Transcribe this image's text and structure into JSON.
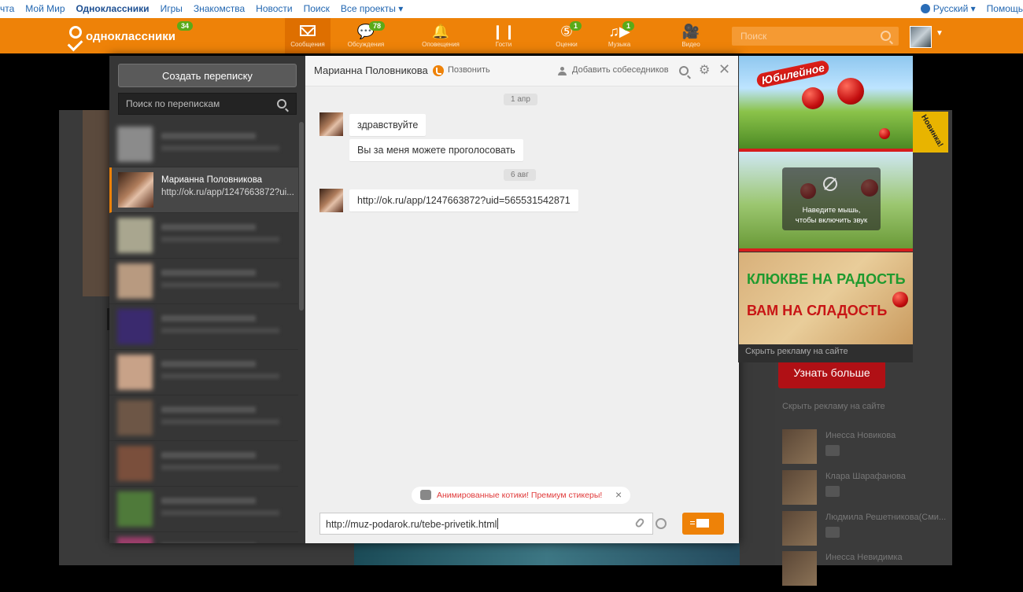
{
  "topbar": {
    "links": [
      "чта",
      "Мой Мир",
      "Одноклассники",
      "Игры",
      "Знакомства",
      "Новости",
      "Поиск",
      "Все проекты ▾"
    ],
    "language": "Русский ▾",
    "help": "Помощь"
  },
  "header": {
    "logo_text": "одноклассники",
    "logo_badge": "34",
    "search_placeholder": "Поиск",
    "nav": [
      {
        "label": "Сообщения",
        "icon": "envelope-icon",
        "badge": ""
      },
      {
        "label": "Обсуждения",
        "icon": "speech-bubbles-icon",
        "badge": "78"
      },
      {
        "label": "Оповещения",
        "icon": "bell-icon",
        "badge": ""
      },
      {
        "label": "Гости",
        "icon": "footprints-icon",
        "badge": ""
      },
      {
        "label": "Оценки",
        "icon": "rating-5-icon",
        "badge": "1"
      },
      {
        "label": "Музыка",
        "icon": "music-note-icon",
        "badge": "1"
      },
      {
        "label": "Видео",
        "icon": "video-camera-icon",
        "badge": ""
      }
    ]
  },
  "sidebar": {
    "create_button": "Создать переписку",
    "search_placeholder": "Поиск по перепискам",
    "active_conversation": {
      "name": "Марианна Половникова",
      "preview": "http://ok.ru/app/1247663872?ui..."
    }
  },
  "chat": {
    "title": "Марианна Половникова",
    "call_label": "Позвонить",
    "add_participants_label": "Добавить собеседников",
    "date1": "1 апр",
    "msg1": "здравствуйте",
    "msg2": "Вы за меня можете проголосовать",
    "date2": "6 авг",
    "msg3": "http://ok.ru/app/1247663872?uid=565531542871",
    "promo_text": "Анимированные котики! Премиум стикеры!",
    "input_value": "http://muz-podarok.ru/tebe-privetik.html"
  },
  "ads": {
    "brand": "Юбилейное",
    "mute_hint_line1": "Наведите мышь,",
    "mute_hint_line2": "чтобы включить звук",
    "slogan_line1": "КЛЮКВЕ НА РАДОСТЬ",
    "slogan_line2": "ВАМ НА СЛАДОСТЬ",
    "hide_label": "Скрыть рекламу на сайте",
    "new_tag": "Новинка!"
  },
  "background": {
    "ad_button": "Узнать больше",
    "hide_label": "Скрыть рекламу на сайте",
    "friends": [
      "Инесса Новикова",
      "Клара Шарафанова",
      "Людмила Решетникова(Сми...",
      "Инесса Невидимка"
    ]
  },
  "colors": {
    "brand_orange": "#ee8208",
    "badge_green": "#5aaa18",
    "promo_red": "#e03a3a"
  }
}
